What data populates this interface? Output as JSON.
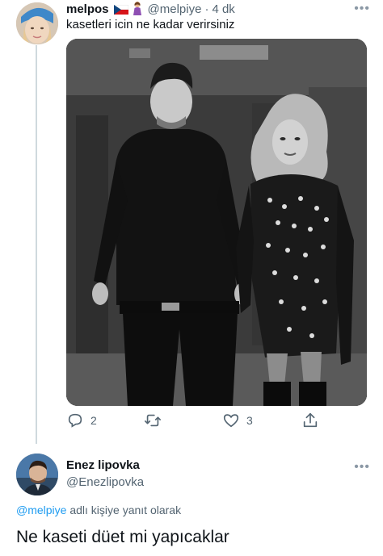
{
  "tweet1": {
    "display_name": "melpos",
    "handle": "@melpiye",
    "separator": "·",
    "time": "4 dk",
    "text": "kasetleri icin ne kadar verirsiniz",
    "flag_icon": "czech-flag-icon",
    "emoji_icon": "woman-emoji-icon",
    "more_label": "•••",
    "actions": {
      "reply_count": "2",
      "retweet_count": "",
      "like_count": "3"
    }
  },
  "tweet2": {
    "display_name": "Enez lipovka",
    "handle": "@Enezlipovka",
    "more_label": "•••",
    "replying_mention": "@melpiye",
    "replying_suffix": "adlı kişiye yanıt olarak",
    "text": "Ne kaseti düet mi yapıcaklar"
  },
  "colors": {
    "link": "#1d9bf0",
    "muted": "#536471",
    "text": "#0f1419",
    "thread_line": "#cfd9de"
  }
}
